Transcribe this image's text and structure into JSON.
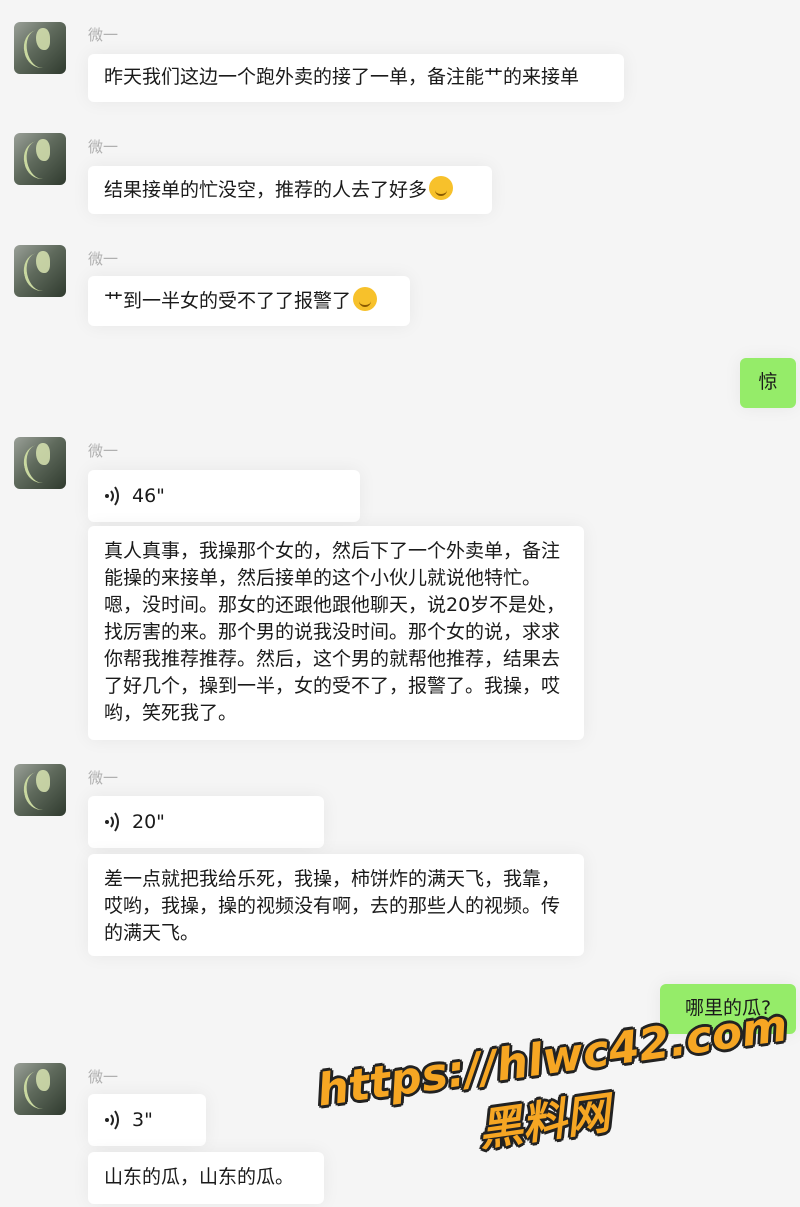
{
  "sender_name": "微一",
  "messages": {
    "m1": "昨天我们这边一个跑外卖的接了一单，备注能艹的来接单",
    "m2": "结果接单的忙没空，推荐的人去了好多",
    "m3": "艹到一半女的受不了了报警了",
    "me1": "惊",
    "voice1": "46\"",
    "t1": "真人真事，我操那个女的，然后下了一个外卖单，备注能操的来接单，然后接单的这个小伙儿就说他特忙。嗯，没时间。那女的还跟他跟他聊天，说20岁不是处，找厉害的来。那个男的说我没时间。那个女的说，求求你帮我推荐推荐。然后，这个男的就帮他推荐，结果去了好几个，操到一半，女的受不了，报警了。我操，哎哟，笑死我了。",
    "voice2": "20\"",
    "t2": "差一点就把我给乐死，我操，柿饼炸的满天飞，我靠，哎哟，我操，操的视频没有啊，去的那些人的视频。传的满天飞。",
    "me2": "哪里的瓜?",
    "voice3": "3\"",
    "t3": "山东的瓜，山东的瓜。"
  },
  "watermark": {
    "url": "https://hlwc42.com",
    "name": "黑料网"
  },
  "colors": {
    "my_bubble": "#95ec69",
    "their_bubble": "#ffffff",
    "background": "#f5f5f5",
    "watermark": "#f6a623"
  },
  "icons": [
    "avatar",
    "voice-wave-icon",
    "emoji-icon"
  ]
}
